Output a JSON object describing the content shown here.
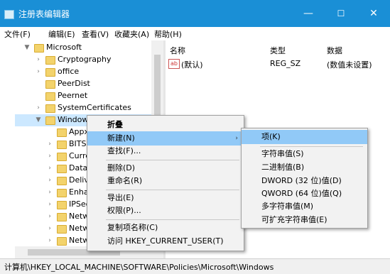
{
  "window": {
    "title": "注册表编辑器",
    "minimize": "—",
    "maximize": "☐",
    "close": "✕"
  },
  "menubar": [
    "文件(F)",
    "编辑(E)",
    "查看(V)",
    "收藏夹(A)",
    "帮助(H)"
  ],
  "tree": {
    "root": "Microsoft",
    "children": [
      "Cryptography",
      "office",
      "PeerDist",
      "Peernet",
      "SystemCertificates",
      "Windows"
    ],
    "windows_children": [
      "Appx",
      "BITS",
      "Curre",
      "Data",
      "Deliv",
      "Enha",
      "IPSec",
      "Netw",
      "Netw",
      "Netw"
    ]
  },
  "list": {
    "headers": {
      "name": "名称",
      "type": "类型",
      "data": "数据"
    },
    "rows": [
      {
        "name": "(默认)",
        "type": "REG_SZ",
        "data": "(数值未设置)",
        "icon": "ab-icon"
      }
    ]
  },
  "context_menu": {
    "items": [
      "折叠",
      "新建(N)",
      "查找(F)...",
      "删除(D)",
      "重命名(R)",
      "导出(E)",
      "权限(P)...",
      "复制项名称(C)",
      "访问 HKEY_CURRENT_USER(T)"
    ],
    "highlighted": "新建(N)"
  },
  "submenu": {
    "items": [
      "项(K)",
      "字符串值(S)",
      "二进制值(B)",
      "DWORD (32 位)值(D)",
      "QWORD (64 位)值(Q)",
      "多字符串值(M)",
      "可扩充字符串值(E)"
    ],
    "highlighted": "项(K)"
  },
  "status": "计算机\\HKEY_LOCAL_MACHINE\\SOFTWARE\\Policies\\Microsoft\\Windows",
  "colors": {
    "titlebar": "#1a8fd6",
    "highlight": "#91c9f7",
    "folder": "#f3d36c"
  }
}
